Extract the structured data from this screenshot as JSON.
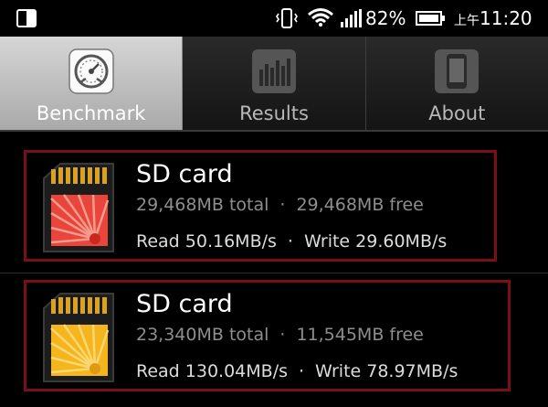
{
  "status_bar": {
    "battery_percent": "82%",
    "time_prefix": "上午",
    "time": "11:20",
    "icons": [
      "screen-icon",
      "vibrate-icon",
      "wifi-icon",
      "signal-icon",
      "battery-icon"
    ]
  },
  "tabs": [
    {
      "label": "Benchmark",
      "icon": "speedometer-icon",
      "active": true
    },
    {
      "label": "Results",
      "icon": "bar-chart-icon",
      "active": false
    },
    {
      "label": "About",
      "icon": "phone-icon",
      "active": false
    }
  ],
  "cards": [
    {
      "title": "SD card",
      "total": "29,468MB total",
      "free": "29,468MB free",
      "read": "Read 50.16MB/s",
      "write": "Write 29.60MB/s",
      "separator": "·",
      "icon_color": "#e8453c"
    },
    {
      "title": "SD card",
      "total": "23,340MB total",
      "free": "11,545MB free",
      "read": "Read 130.04MB/s",
      "write": "Write 78.97MB/s",
      "separator": "·",
      "icon_color": "#f5b51c"
    }
  ],
  "colors": {
    "highlight_border": "#7a0f18",
    "active_tab": "#c0c0c0"
  }
}
